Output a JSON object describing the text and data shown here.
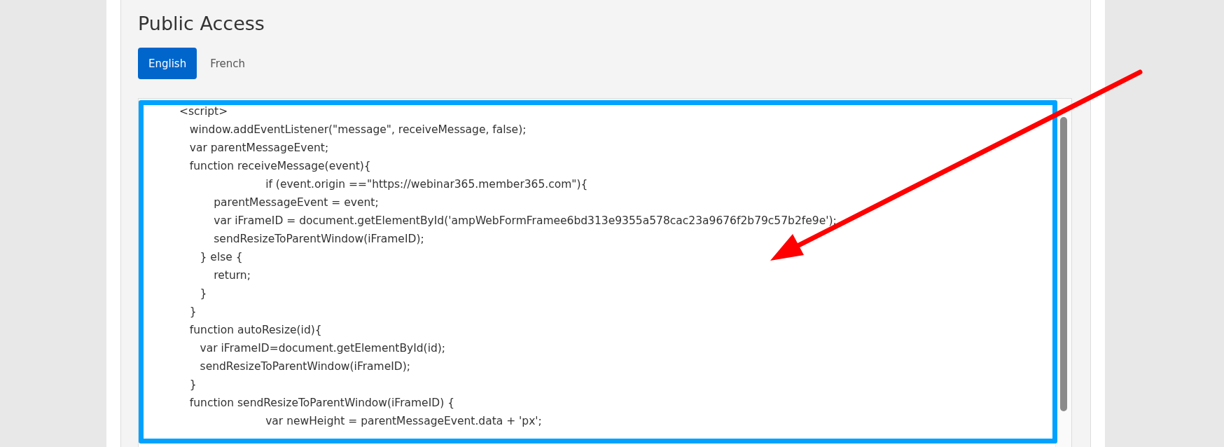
{
  "section": {
    "title": "Public Access"
  },
  "tabs": [
    {
      "label": "English",
      "selected": true
    },
    {
      "label": "French",
      "selected": false
    }
  ],
  "code_editor": {
    "lines": [
      "<script>",
      "   window.addEventListener(\"message\", receiveMessage, false);",
      "   var parentMessageEvent;",
      "   function receiveMessage(event){",
      "                         if (event.origin ==\"https://webinar365.member365.com\"){",
      "          parentMessageEvent = event;",
      "          var iFrameID = document.getElementById('ampWebFormFramee6bd313e9355a578cac23a9676f2b79c57b2fe9e');",
      "          sendResizeToParentWindow(iFrameID);",
      "      } else {",
      "          return;",
      "      }",
      "   }",
      "   function autoResize(id){",
      "      var iFrameID=document.getElementById(id);",
      "      sendResizeToParentWindow(iFrameID);",
      "   }",
      "   function sendResizeToParentWindow(iFrameID) {",
      "                         var newHeight = parentMessageEvent.data + 'px';"
    ]
  }
}
